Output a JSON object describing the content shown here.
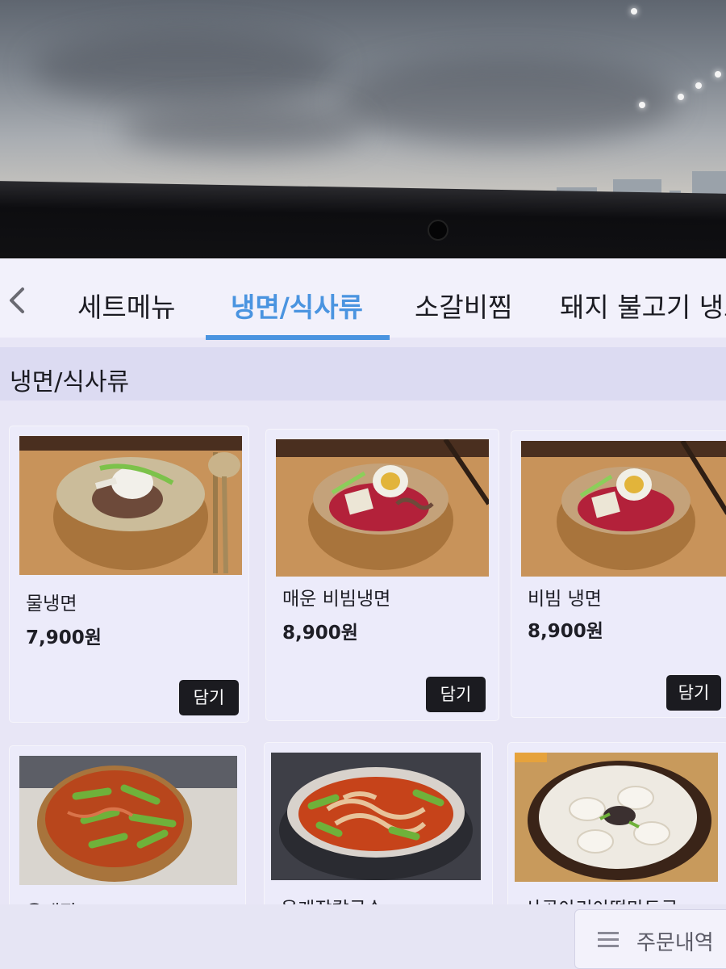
{
  "tabs": [
    {
      "label": "세트메뉴",
      "active": false
    },
    {
      "label": "냉면/식사류",
      "active": true
    },
    {
      "label": "소갈비찜",
      "active": false
    },
    {
      "label": "돼지 불고기 냉스",
      "active": false
    }
  ],
  "section_title": "냉면/식사류",
  "menu_items": [
    {
      "name": "물냉면",
      "price": "7,900원",
      "add_label": "담기",
      "photo": "mul-naengmyeon-photo"
    },
    {
      "name": "매운 비빔냉면",
      "price": "8,900원",
      "add_label": "담기",
      "photo": "spicy-bibim-naengmyeon-photo"
    },
    {
      "name": "비빔 냉면",
      "price": "8,900원",
      "add_label": "담기",
      "photo": "bibim-naengmyeon-photo"
    },
    {
      "name": "육개장",
      "photo": "yukgaejang-photo"
    },
    {
      "name": "육개장칼국수",
      "photo": "yukgaejang-kalguksu-photo"
    },
    {
      "name": "사골아리아떡만두국",
      "photo": "tteok-mandu-guk-photo"
    }
  ],
  "order_history_label": "주문내역"
}
